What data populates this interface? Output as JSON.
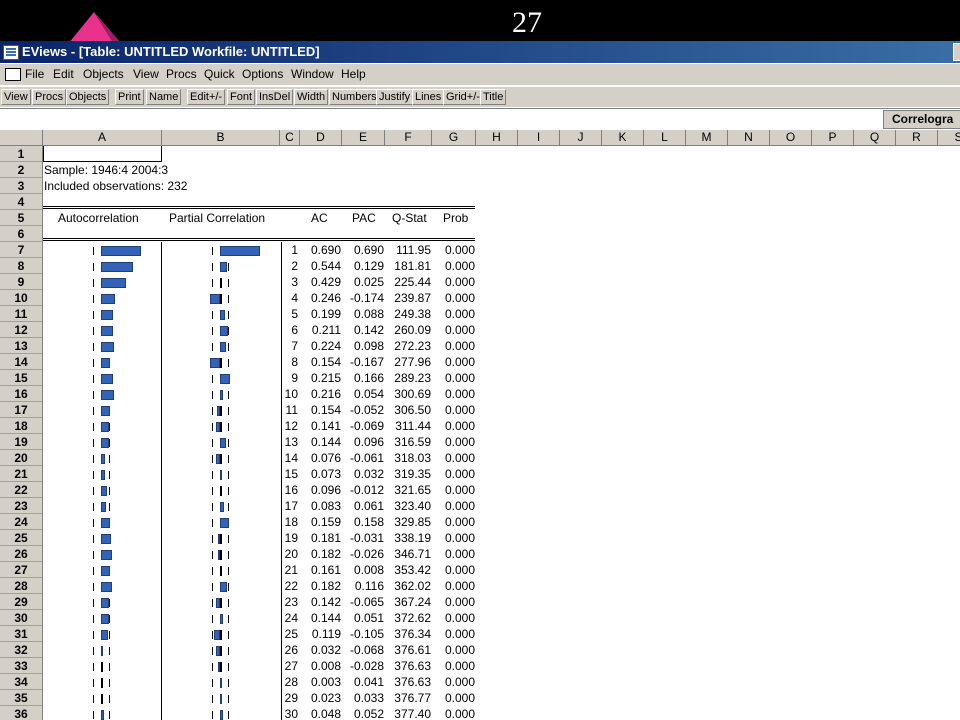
{
  "slide_number": "27",
  "window": {
    "title": "EViews - [Table: UNTITLED    Workfile: UNTITLED]"
  },
  "menu": [
    "File",
    "Edit",
    "Objects",
    "View",
    "Procs",
    "Quick",
    "Options",
    "Window",
    "Help"
  ],
  "toolbar": [
    "View",
    "Procs",
    "Objects",
    "Print",
    "Name",
    "Edit+/-",
    "Font",
    "InsDel",
    "Width",
    "Numbers",
    "Justify",
    "Lines",
    "Grid+/-",
    "Title"
  ],
  "edit_box_label": "Correlogra",
  "columns": [
    "A",
    "B",
    "C",
    "D",
    "E",
    "F",
    "G",
    "H",
    "I",
    "J",
    "K",
    "L",
    "M",
    "N",
    "O",
    "P",
    "Q",
    "R",
    "S"
  ],
  "rows": [
    "1",
    "2",
    "3",
    "4",
    "5",
    "6",
    "7",
    "8",
    "9",
    "10",
    "11",
    "12",
    "13",
    "14",
    "15",
    "16",
    "17",
    "18",
    "19",
    "20",
    "21",
    "22",
    "23",
    "24",
    "25",
    "26",
    "27",
    "28",
    "29",
    "30",
    "31",
    "32",
    "33",
    "34",
    "35",
    "36"
  ],
  "sample_text": "Sample: 1946:4 2004:3",
  "obs_text": "Included observations: 232",
  "headers": {
    "autocorrelation": "Autocorrelation",
    "partial": "Partial Correlation",
    "ac": "AC",
    "pac": "PAC",
    "qstat": "Q-Stat",
    "prob": "Prob"
  },
  "correlogram": [
    {
      "lag": "1",
      "ac": "0.690",
      "pac": "0.690",
      "q": "111.95",
      "p": "0.000"
    },
    {
      "lag": "2",
      "ac": "0.544",
      "pac": "0.129",
      "q": "181.81",
      "p": "0.000"
    },
    {
      "lag": "3",
      "ac": "0.429",
      "pac": "0.025",
      "q": "225.44",
      "p": "0.000"
    },
    {
      "lag": "4",
      "ac": "0.246",
      "pac": "-0.174",
      "q": "239.87",
      "p": "0.000"
    },
    {
      "lag": "5",
      "ac": "0.199",
      "pac": "0.088",
      "q": "249.38",
      "p": "0.000"
    },
    {
      "lag": "6",
      "ac": "0.211",
      "pac": "0.142",
      "q": "260.09",
      "p": "0.000"
    },
    {
      "lag": "7",
      "ac": "0.224",
      "pac": "0.098",
      "q": "272.23",
      "p": "0.000"
    },
    {
      "lag": "8",
      "ac": "0.154",
      "pac": "-0.167",
      "q": "277.96",
      "p": "0.000"
    },
    {
      "lag": "9",
      "ac": "0.215",
      "pac": "0.166",
      "q": "289.23",
      "p": "0.000"
    },
    {
      "lag": "10",
      "ac": "0.216",
      "pac": "0.054",
      "q": "300.69",
      "p": "0.000"
    },
    {
      "lag": "11",
      "ac": "0.154",
      "pac": "-0.052",
      "q": "306.50",
      "p": "0.000"
    },
    {
      "lag": "12",
      "ac": "0.141",
      "pac": "-0.069",
      "q": "311.44",
      "p": "0.000"
    },
    {
      "lag": "13",
      "ac": "0.144",
      "pac": "0.096",
      "q": "316.59",
      "p": "0.000"
    },
    {
      "lag": "14",
      "ac": "0.076",
      "pac": "-0.061",
      "q": "318.03",
      "p": "0.000"
    },
    {
      "lag": "15",
      "ac": "0.073",
      "pac": "0.032",
      "q": "319.35",
      "p": "0.000"
    },
    {
      "lag": "16",
      "ac": "0.096",
      "pac": "-0.012",
      "q": "321.65",
      "p": "0.000"
    },
    {
      "lag": "17",
      "ac": "0.083",
      "pac": "0.061",
      "q": "323.40",
      "p": "0.000"
    },
    {
      "lag": "18",
      "ac": "0.159",
      "pac": "0.158",
      "q": "329.85",
      "p": "0.000"
    },
    {
      "lag": "19",
      "ac": "0.181",
      "pac": "-0.031",
      "q": "338.19",
      "p": "0.000"
    },
    {
      "lag": "20",
      "ac": "0.182",
      "pac": "-0.026",
      "q": "346.71",
      "p": "0.000"
    },
    {
      "lag": "21",
      "ac": "0.161",
      "pac": "0.008",
      "q": "353.42",
      "p": "0.000"
    },
    {
      "lag": "22",
      "ac": "0.182",
      "pac": "0.116",
      "q": "362.02",
      "p": "0.000"
    },
    {
      "lag": "23",
      "ac": "0.142",
      "pac": "-0.065",
      "q": "367.24",
      "p": "0.000"
    },
    {
      "lag": "24",
      "ac": "0.144",
      "pac": "0.051",
      "q": "372.62",
      "p": "0.000"
    },
    {
      "lag": "25",
      "ac": "0.119",
      "pac": "-0.105",
      "q": "376.34",
      "p": "0.000"
    },
    {
      "lag": "26",
      "ac": "0.032",
      "pac": "-0.068",
      "q": "376.61",
      "p": "0.000"
    },
    {
      "lag": "27",
      "ac": "0.008",
      "pac": "-0.028",
      "q": "376.63",
      "p": "0.000"
    },
    {
      "lag": "28",
      "ac": "0.003",
      "pac": "0.041",
      "q": "376.63",
      "p": "0.000"
    },
    {
      "lag": "29",
      "ac": "0.023",
      "pac": "0.033",
      "q": "376.77",
      "p": "0.000"
    },
    {
      "lag": "30",
      "ac": "0.048",
      "pac": "0.052",
      "q": "377.40",
      "p": "0.000"
    }
  ],
  "colors": {
    "bar": "#3462b6",
    "titlebar": "#0a246a",
    "chrome": "#d4d0c8"
  }
}
